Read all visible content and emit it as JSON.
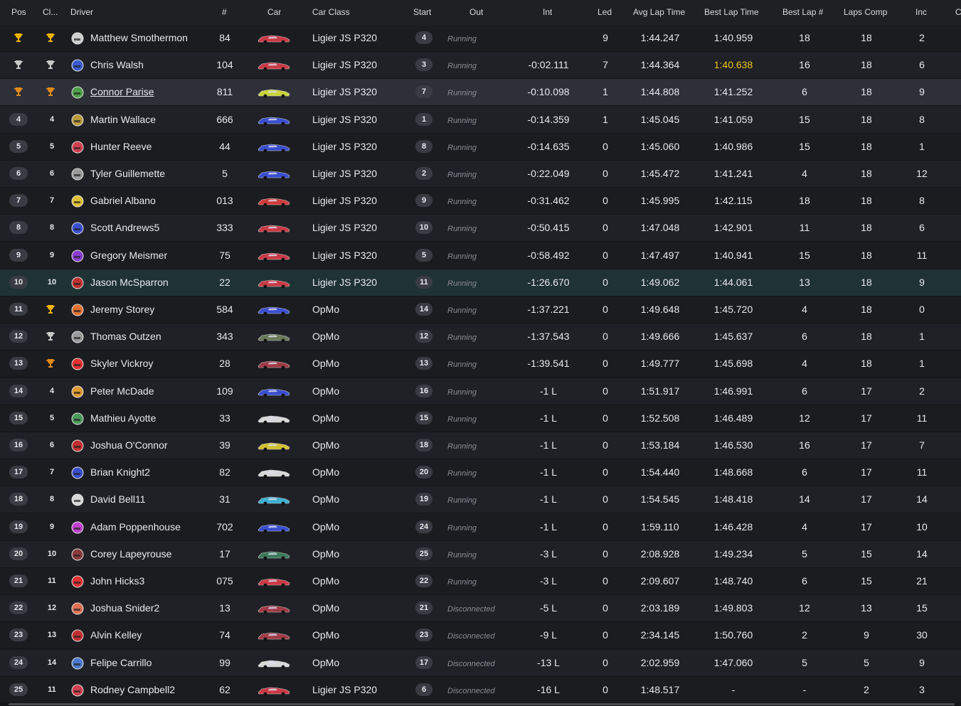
{
  "columns": {
    "pos": "Pos",
    "cls": "Cl...",
    "driver": "Driver",
    "num": "#",
    "car": "Car",
    "car_class": "Car Class",
    "start": "Start",
    "out": "Out",
    "int": "Int",
    "led": "Led",
    "avg": "Avg Lap Time",
    "best": "Best Lap Time",
    "bestnum": "Best Lap #",
    "laps": "Laps Comp",
    "inc": "Inc",
    "extra": "C"
  },
  "colors": {
    "gold": "#f0b400",
    "silver": "#c8c8c8",
    "bronze": "#e08a1a",
    "best_highlight": "#f0c419",
    "row_highlight": "#2e3038",
    "row_teal": "#1f3234"
  },
  "rows": [
    {
      "pos": "",
      "cls": "",
      "trophy_pos": "gold",
      "trophy_cls": "gold",
      "driver": "Matthew Smothermon",
      "num": "84",
      "car_color": "#c93a46",
      "car_class": "Ligier JS P320",
      "start": "4",
      "out": "Running",
      "int": "",
      "led": "9",
      "avg": "1:44.247",
      "best": "1:40.959",
      "bestnum": "18",
      "laps": "18",
      "inc": "2",
      "helmet": "#cfcfcf"
    },
    {
      "pos": "",
      "cls": "",
      "trophy_pos": "silver",
      "trophy_cls": "silver",
      "driver": "Chris Walsh",
      "num": "104",
      "car_color": "#c93a46",
      "car_class": "Ligier JS P320",
      "start": "3",
      "out": "Running",
      "int": "-0:02.111",
      "led": "7",
      "avg": "1:44.364",
      "best": "1:40.638",
      "best_hl": true,
      "bestnum": "16",
      "laps": "18",
      "inc": "6",
      "helmet": "#3a5bd0"
    },
    {
      "pos": "",
      "cls": "",
      "trophy_pos": "bronze",
      "trophy_cls": "bronze",
      "driver": "Connor Parise",
      "num": "811",
      "car_color": "#c8d43a",
      "car_class": "Ligier JS P320",
      "start": "7",
      "out": "Running",
      "int": "-0:10.098",
      "led": "1",
      "avg": "1:44.808",
      "best": "1:41.252",
      "bestnum": "6",
      "laps": "18",
      "inc": "9",
      "helmet": "#4ea04a"
    },
    {
      "pos": "4",
      "cls": "4",
      "driver": "Martin Wallace",
      "num": "666",
      "car_color": "#3a4fd0",
      "car_class": "Ligier JS P320",
      "start": "1",
      "out": "Running",
      "int": "-0:14.359",
      "led": "1",
      "avg": "1:45.045",
      "best": "1:41.059",
      "bestnum": "15",
      "laps": "18",
      "inc": "8",
      "helmet": "#b89a3a"
    },
    {
      "pos": "5",
      "cls": "5",
      "driver": "Hunter Reeve",
      "num": "44",
      "car_color": "#3a4fd0",
      "car_class": "Ligier JS P320",
      "start": "8",
      "out": "Running",
      "int": "-0:14.635",
      "led": "0",
      "avg": "1:45.060",
      "best": "1:40.986",
      "bestnum": "15",
      "laps": "18",
      "inc": "1",
      "helmet": "#d04050"
    },
    {
      "pos": "6",
      "cls": "6",
      "driver": "Tyler Guillemette",
      "num": "5",
      "car_color": "#3a4fd0",
      "car_class": "Ligier JS P320",
      "start": "2",
      "out": "Running",
      "int": "-0:22.049",
      "led": "0",
      "avg": "1:45.472",
      "best": "1:41.241",
      "bestnum": "4",
      "laps": "18",
      "inc": "12",
      "helmet": "#9a9a9a"
    },
    {
      "pos": "7",
      "cls": "7",
      "driver": "Gabriel Albano",
      "num": "013",
      "car_color": "#d03a3a",
      "car_class": "Ligier JS P320",
      "start": "9",
      "out": "Running",
      "int": "-0:31.462",
      "led": "0",
      "avg": "1:45.995",
      "best": "1:42.115",
      "bestnum": "18",
      "laps": "18",
      "inc": "8",
      "helmet": "#e0c030"
    },
    {
      "pos": "8",
      "cls": "8",
      "driver": "Scott Andrews5",
      "num": "333",
      "car_color": "#c93a46",
      "car_class": "Ligier JS P320",
      "start": "10",
      "out": "Running",
      "int": "-0:50.415",
      "led": "0",
      "avg": "1:47.048",
      "best": "1:42.901",
      "bestnum": "11",
      "laps": "18",
      "inc": "6",
      "helmet": "#3a4fd0"
    },
    {
      "pos": "9",
      "cls": "9",
      "driver": "Gregory Meismer",
      "num": "75",
      "car_color": "#c93a46",
      "car_class": "Ligier JS P320",
      "start": "5",
      "out": "Running",
      "int": "-0:58.492",
      "led": "0",
      "avg": "1:47.497",
      "best": "1:40.941",
      "bestnum": "15",
      "laps": "18",
      "inc": "11",
      "helmet": "#8a3ad0"
    },
    {
      "pos": "10",
      "cls": "10",
      "driver": "Jason McSparron",
      "num": "22",
      "car_color": "#c93a46",
      "car_class": "Ligier JS P320",
      "start": "11",
      "out": "Running",
      "int": "-1:26.670",
      "led": "0",
      "avg": "1:49.062",
      "best": "1:44.061",
      "bestnum": "13",
      "laps": "18",
      "inc": "9",
      "helmet": "#c03030"
    },
    {
      "pos": "11",
      "cls": "",
      "trophy_cls": "gold",
      "driver": "Jeremy Storey",
      "num": "584",
      "car_color": "#3a4fd0",
      "car_class": "OpMo",
      "start": "14",
      "out": "Running",
      "int": "-1:37.221",
      "led": "0",
      "avg": "1:49.648",
      "best": "1:45.720",
      "bestnum": "4",
      "laps": "18",
      "inc": "0",
      "helmet": "#e07030"
    },
    {
      "pos": "12",
      "cls": "",
      "trophy_cls": "silver",
      "driver": "Thomas Outzen",
      "num": "343",
      "car_color": "#6a7a5a",
      "car_class": "OpMo",
      "start": "12",
      "out": "Running",
      "int": "-1:37.543",
      "led": "0",
      "avg": "1:49.666",
      "best": "1:45.637",
      "bestnum": "6",
      "laps": "18",
      "inc": "1",
      "helmet": "#9a9a9a"
    },
    {
      "pos": "13",
      "cls": "",
      "trophy_cls": "bronze",
      "driver": "Skyler Vickroy",
      "num": "28",
      "car_color": "#a03a46",
      "car_class": "OpMo",
      "start": "13",
      "out": "Running",
      "int": "-1:39.541",
      "led": "0",
      "avg": "1:49.777",
      "best": "1:45.698",
      "bestnum": "4",
      "laps": "18",
      "inc": "1",
      "helmet": "#e03030"
    },
    {
      "pos": "14",
      "cls": "4",
      "driver": "Peter McDade",
      "num": "109",
      "car_color": "#3a4fd0",
      "car_class": "OpMo",
      "start": "16",
      "out": "Running",
      "int": "-1 L",
      "led": "0",
      "avg": "1:51.917",
      "best": "1:46.991",
      "bestnum": "6",
      "laps": "17",
      "inc": "2",
      "helmet": "#e09a30"
    },
    {
      "pos": "15",
      "cls": "5",
      "driver": "Mathieu Ayotte",
      "num": "33",
      "car_color": "#d8d8d8",
      "car_class": "OpMo",
      "start": "15",
      "out": "Running",
      "int": "-1 L",
      "led": "0",
      "avg": "1:52.508",
      "best": "1:46.489",
      "bestnum": "12",
      "laps": "17",
      "inc": "11",
      "helmet": "#4a9a5a"
    },
    {
      "pos": "16",
      "cls": "6",
      "driver": "Joshua O'Connor",
      "num": "39",
      "car_color": "#d0c030",
      "car_class": "OpMo",
      "start": "18",
      "out": "Running",
      "int": "-1 L",
      "led": "0",
      "avg": "1:53.184",
      "best": "1:46.530",
      "bestnum": "16",
      "laps": "17",
      "inc": "7",
      "helmet": "#c03030"
    },
    {
      "pos": "17",
      "cls": "7",
      "driver": "Brian Knight2",
      "num": "82",
      "car_color": "#d8d8d8",
      "car_class": "OpMo",
      "start": "20",
      "out": "Running",
      "int": "-1 L",
      "led": "0",
      "avg": "1:54.440",
      "best": "1:48.668",
      "bestnum": "6",
      "laps": "17",
      "inc": "11",
      "helmet": "#3a4fd0"
    },
    {
      "pos": "18",
      "cls": "8",
      "driver": "David Bell11",
      "num": "31",
      "car_color": "#3ab0d0",
      "car_class": "OpMo",
      "start": "19",
      "out": "Running",
      "int": "-1 L",
      "led": "0",
      "avg": "1:54.545",
      "best": "1:48.418",
      "bestnum": "14",
      "laps": "17",
      "inc": "14",
      "helmet": "#d8d8d8"
    },
    {
      "pos": "19",
      "cls": "9",
      "driver": "Adam Poppenhouse",
      "num": "702",
      "car_color": "#3a4fd0",
      "car_class": "OpMo",
      "start": "24",
      "out": "Running",
      "int": "-1 L",
      "led": "0",
      "avg": "1:59.110",
      "best": "1:46.428",
      "bestnum": "4",
      "laps": "17",
      "inc": "10",
      "helmet": "#c040d0"
    },
    {
      "pos": "20",
      "cls": "10",
      "driver": "Corey Lapeyrouse",
      "num": "17",
      "car_color": "#3a7a5a",
      "car_class": "OpMo",
      "start": "25",
      "out": "Running",
      "int": "-3 L",
      "led": "0",
      "avg": "2:08.928",
      "best": "1:49.234",
      "bestnum": "5",
      "laps": "15",
      "inc": "14",
      "helmet": "#8a3a3a"
    },
    {
      "pos": "21",
      "cls": "11",
      "driver": "John Hicks3",
      "num": "075",
      "car_color": "#c93a46",
      "car_class": "OpMo",
      "start": "22",
      "out": "Running",
      "int": "-3 L",
      "led": "0",
      "avg": "2:09.607",
      "best": "1:48.740",
      "bestnum": "6",
      "laps": "15",
      "inc": "21",
      "helmet": "#e03030"
    },
    {
      "pos": "22",
      "cls": "12",
      "driver": "Joshua Snider2",
      "num": "13",
      "car_color": "#a03a46",
      "car_class": "OpMo",
      "start": "21",
      "out": "Disconnected",
      "int": "-5 L",
      "led": "0",
      "avg": "2:03.189",
      "best": "1:49.803",
      "bestnum": "12",
      "laps": "13",
      "inc": "15",
      "helmet": "#e07050"
    },
    {
      "pos": "23",
      "cls": "13",
      "driver": "Alvin Kelley",
      "num": "74",
      "car_color": "#a03a46",
      "car_class": "OpMo",
      "start": "23",
      "out": "Disconnected",
      "int": "-9 L",
      "led": "0",
      "avg": "2:34.145",
      "best": "1:50.760",
      "bestnum": "2",
      "laps": "9",
      "inc": "30",
      "helmet": "#c03030"
    },
    {
      "pos": "24",
      "cls": "14",
      "driver": "Felipe Carrillo",
      "num": "99",
      "car_color": "#d8d8d8",
      "car_class": "OpMo",
      "start": "17",
      "out": "Disconnected",
      "int": "-13 L",
      "led": "0",
      "avg": "2:02.959",
      "best": "1:47.060",
      "bestnum": "5",
      "laps": "5",
      "inc": "9",
      "helmet": "#4a7ad0"
    },
    {
      "pos": "25",
      "cls": "11",
      "driver": "Rodney Campbell2",
      "num": "62",
      "car_color": "#c93a46",
      "car_class": "Ligier JS P320",
      "start": "6",
      "out": "Disconnected",
      "int": "-16 L",
      "led": "0",
      "avg": "1:48.517",
      "best": "-",
      "bestnum": "-",
      "laps": "2",
      "inc": "3",
      "helmet": "#d04050"
    }
  ]
}
